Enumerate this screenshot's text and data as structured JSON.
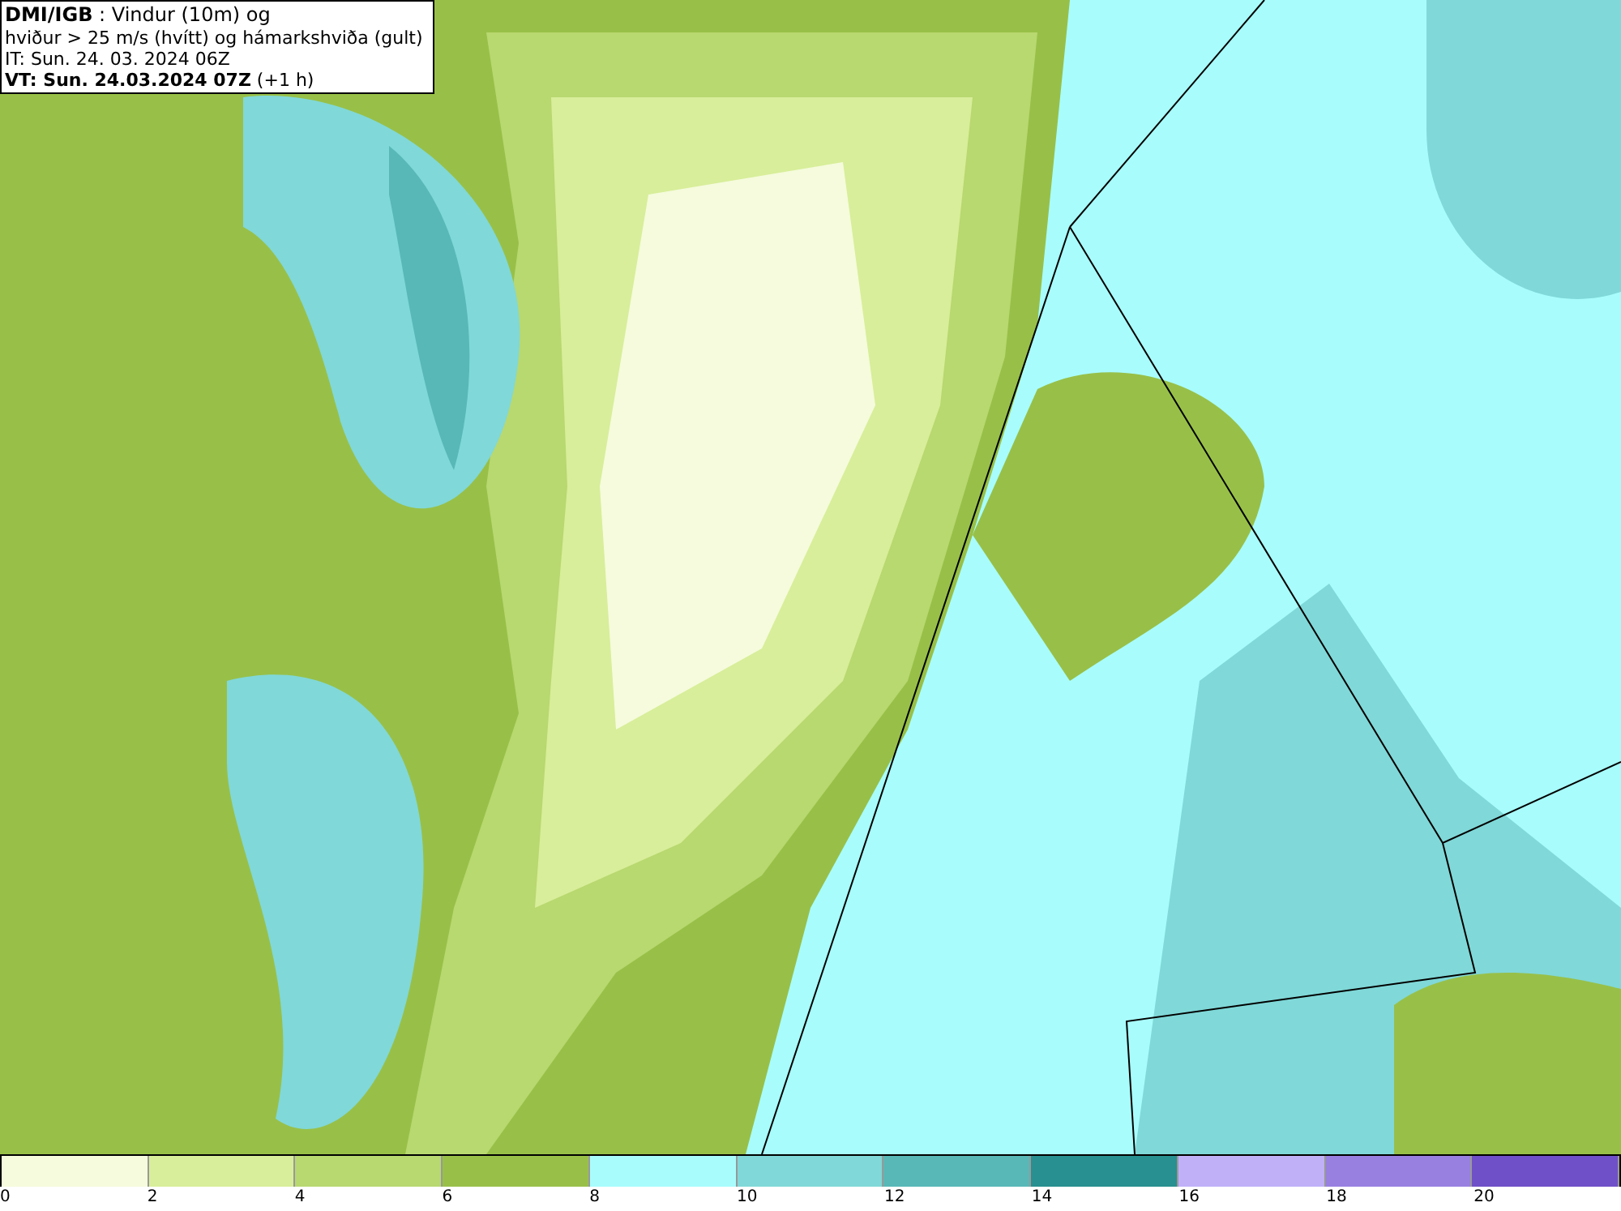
{
  "legend": {
    "lines": [
      "**DMI/IGB** : Vindur (10m) og",
      "hviður > 25 m/s (hvítt) og hámarkshviða (gult)",
      "IT: Sun. 24. 03. 2024 06Z",
      "**VT: Sun. 24.03.2024 07Z** (+1 h)"
    ]
  },
  "colorbar": {
    "segments": [
      {
        "color": "#f5fbdc"
      },
      {
        "color": "#d8ee9a"
      },
      {
        "color": "#b8d870"
      },
      {
        "color": "#98c048"
      },
      {
        "color": "#a8fcfc"
      },
      {
        "color": "#80d8d8"
      },
      {
        "color": "#58b8b8"
      },
      {
        "color": "#289090"
      },
      {
        "color": "#c0b0f8"
      },
      {
        "color": "#9880e0"
      },
      {
        "color": "#7050c8"
      }
    ],
    "ticks": [
      "0",
      "2",
      "4",
      "6",
      "8",
      "10",
      "12",
      "14",
      "16",
      "18",
      "20"
    ]
  }
}
